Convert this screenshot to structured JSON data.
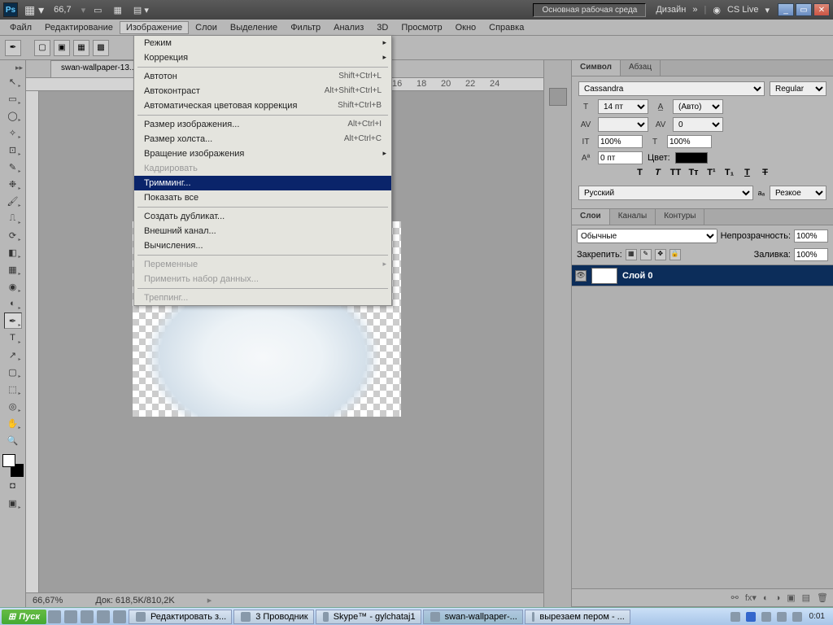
{
  "title": {
    "zoom": "66,7",
    "workspace_main": "Основная рабочая среда",
    "workspace_design": "Дизайн",
    "cslive": "CS Live"
  },
  "menubar": [
    "Файл",
    "Редактирование",
    "Изображение",
    "Слои",
    "Выделение",
    "Фильтр",
    "Анализ",
    "3D",
    "Просмотр",
    "Окно",
    "Справка"
  ],
  "open_menu_index": 2,
  "dropdown": [
    {
      "label": "Режим",
      "shortcut": "",
      "arrow": true
    },
    {
      "label": "Коррекция",
      "shortcut": "",
      "arrow": true
    },
    {
      "sep": true
    },
    {
      "label": "Автотон",
      "shortcut": "Shift+Ctrl+L"
    },
    {
      "label": "Автоконтраст",
      "shortcut": "Alt+Shift+Ctrl+L"
    },
    {
      "label": "Автоматическая цветовая коррекция",
      "shortcut": "Shift+Ctrl+B"
    },
    {
      "sep": true
    },
    {
      "label": "Размер изображения...",
      "shortcut": "Alt+Ctrl+I"
    },
    {
      "label": "Размер холста...",
      "shortcut": "Alt+Ctrl+C"
    },
    {
      "label": "Вращение изображения",
      "shortcut": "",
      "arrow": true
    },
    {
      "label": "Кадрировать",
      "shortcut": "",
      "disabled": true
    },
    {
      "label": "Тримминг...",
      "shortcut": "",
      "highlighted": true
    },
    {
      "label": "Показать все",
      "shortcut": ""
    },
    {
      "sep": true
    },
    {
      "label": "Создать дубликат...",
      "shortcut": ""
    },
    {
      "label": "Внешний канал...",
      "shortcut": ""
    },
    {
      "label": "Вычисления...",
      "shortcut": ""
    },
    {
      "sep": true
    },
    {
      "label": "Переменные",
      "shortcut": "",
      "arrow": true,
      "disabled": true
    },
    {
      "label": "Применить набор данных...",
      "shortcut": "",
      "disabled": true
    },
    {
      "sep": true
    },
    {
      "label": "Треппинг...",
      "shortcut": "",
      "disabled": true
    }
  ],
  "doc_tab": "swan-wallpaper-13...",
  "ruler_marks": [
    "16",
    "18",
    "20",
    "22",
    "24"
  ],
  "status": {
    "zoom": "66,67%",
    "doc": "Док: 618,5K/810,2K"
  },
  "char_panel": {
    "tab1": "Символ",
    "tab2": "Абзац",
    "font": "Cassandra",
    "style": "Regular",
    "size_label": "14 пт",
    "leading": "(Авто)",
    "tracking": "0",
    "vscale": "100%",
    "hscale": "100%",
    "baseline": "0 пт",
    "color_label": "Цвет:",
    "lang": "Русский",
    "aa": "Резкое"
  },
  "layers_panel": {
    "tabs": [
      "Слои",
      "Каналы",
      "Контуры"
    ],
    "blend": "Обычные",
    "opacity_label": "Непрозрачность:",
    "opacity": "100%",
    "lock_label": "Закрепить:",
    "fill_label": "Заливка:",
    "fill": "100%",
    "layer_name": "Слой 0"
  },
  "taskbar": {
    "start": "Пуск",
    "tasks": [
      {
        "label": "Редактировать з..."
      },
      {
        "label": "3 Проводник"
      },
      {
        "label": "Skype™ - gylchataj1"
      },
      {
        "label": "swan-wallpaper-...",
        "active": true
      },
      {
        "label": "вырезаем пером - ..."
      }
    ],
    "clock": "0:01"
  }
}
